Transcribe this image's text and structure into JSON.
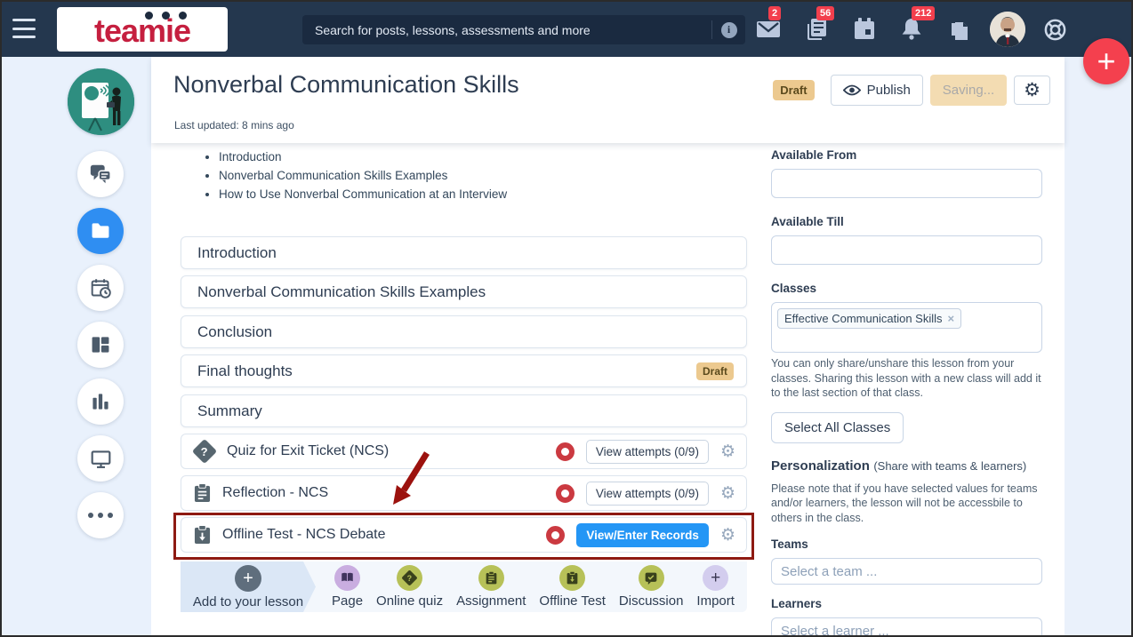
{
  "navbar": {
    "logo_text": "teamie",
    "search_placeholder": "Search for posts, lessons, assessments and more",
    "badges": {
      "messages": "2",
      "posts": "56",
      "notifications": "212"
    }
  },
  "header": {
    "title": "Nonverbal Communication Skills",
    "last_updated": "Last updated: 8 mins ago",
    "status_badge": "Draft",
    "publish_label": "Publish",
    "saving_label": "Saving..."
  },
  "toc": {
    "items": [
      "Introduction",
      "Nonverbal Communication Skills Examples",
      "How to Use Nonverbal Communication at an Interview"
    ]
  },
  "sections": [
    {
      "title": "Introduction"
    },
    {
      "title": "Nonverbal Communication Skills Examples"
    },
    {
      "title": "Conclusion"
    },
    {
      "title": "Final thoughts",
      "badge": "Draft"
    },
    {
      "title": "Summary"
    }
  ],
  "activities": [
    {
      "title": "Quiz for Exit Ticket (NCS)",
      "icon": "quiz-icon",
      "action": "View attempts (0/9)"
    },
    {
      "title": "Reflection - NCS",
      "icon": "assignment-icon",
      "action": "View attempts (0/9)"
    },
    {
      "title": "Offline Test - NCS Debate",
      "icon": "offline-test-icon",
      "action": "View/Enter Records",
      "highlighted": true
    }
  ],
  "toolbar": {
    "add_label": "Add to your lesson",
    "items": [
      {
        "label": "Page",
        "icon": "page-icon"
      },
      {
        "label": "Online quiz",
        "icon": "online-quiz-icon"
      },
      {
        "label": "Assignment",
        "icon": "assignment-icon"
      },
      {
        "label": "Offline Test",
        "icon": "offline-test-icon"
      },
      {
        "label": "Discussion",
        "icon": "discussion-icon"
      },
      {
        "label": "Import",
        "icon": "import-icon"
      }
    ]
  },
  "settings_panel": {
    "available_from_label": "Available From",
    "available_till_label": "Available Till",
    "classes_label": "Classes",
    "class_tag": "Effective Communication Skills",
    "classes_note": "You can only share/unshare this lesson from your classes. Sharing this lesson with a new class will add it to the last section of that class.",
    "select_all_classes_label": "Select All Classes",
    "personalization_title": "Personalization",
    "personalization_subtitle": "(Share with teams & learners)",
    "personalization_note": "Please note that if you have selected values for teams and/or learners, the lesson will not be accessbile to others in the class.",
    "teams_label": "Teams",
    "teams_placeholder": "Select a team ...",
    "learners_label": "Learners",
    "learners_placeholder": "Select a learner ..."
  },
  "icons": {
    "gear": "⚙",
    "plus": "+",
    "close": "×",
    "info": "i",
    "question": "?"
  },
  "colors": {
    "navbar_bg": "#24374e",
    "badge_red": "#f23f4d",
    "fab_red": "#f4404e",
    "active_blue": "#2f8ef2",
    "primary_button_blue": "#2496f5",
    "draft_badge_bg": "#ecc98f",
    "olive_icon": "#b7c158",
    "purple_icon": "#c9ade0",
    "lavender_icon": "#d3cdee",
    "status_ring_red": "#cb3a41",
    "annotation_red": "#8e1a12",
    "sidebar_bg": "#e9f1fc"
  }
}
